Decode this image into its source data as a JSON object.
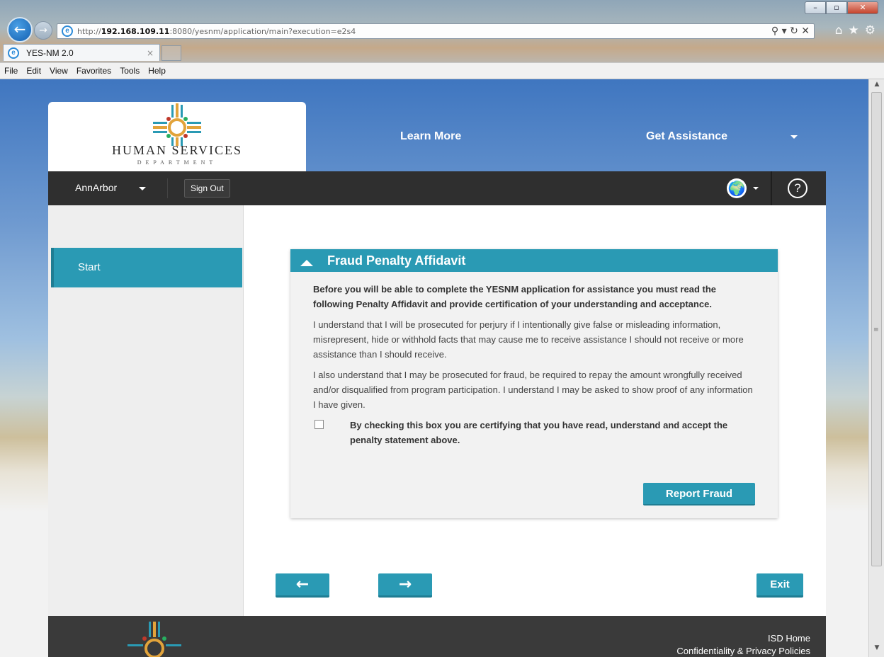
{
  "browser": {
    "url_prefix": "http://",
    "url_host": "192.168.109.11",
    "url_rest": ":8080/yesnm/application/main?execution=e2s4",
    "address_tools": "⚲ ▾ ↻ ✕",
    "tab_title": "YES-NM 2.0",
    "tab_close": "×",
    "menu": [
      "File",
      "Edit",
      "View",
      "Favorites",
      "Tools",
      "Help"
    ],
    "window_controls": {
      "minimize": "–",
      "maximize": "▫",
      "close": "✕"
    }
  },
  "header": {
    "logo_main": "HUMAN  SERVICES",
    "logo_sub": "DEPARTMENT",
    "links": {
      "learn_more": "Learn More",
      "get_assistance": "Get Assistance"
    }
  },
  "userbar": {
    "username": "AnnArbor",
    "sign_out": "Sign Out",
    "help": "?"
  },
  "sidenav": {
    "items": [
      {
        "label": "Start"
      }
    ]
  },
  "affidavit": {
    "title": "Fraud Penalty Affidavit",
    "intro": "Before you will be able to complete the YESNM application for assistance you must read the following Penalty Affidavit and provide certification of your understanding and acceptance.",
    "paragraph1": "I understand that I will be prosecuted for perjury if I intentionally give false or misleading information, misrepresent, hide or withhold facts that may cause me to receive assistance I should not receive or more assistance than I should receive.",
    "paragraph2": "I also understand that I may be prosecuted for fraud, be required to repay the amount wrongfully received and/or disqualified from program participation. I understand I may be asked to show proof of any information I have given.",
    "certification": "By checking this box you are certifying that you have read, understand and accept the penalty statement above.",
    "report_fraud": "Report Fraud"
  },
  "navigation": {
    "back": "←",
    "next": "→",
    "exit": "Exit"
  },
  "footer": {
    "isd_home": "ISD Home",
    "privacy": "Confidentiality & Privacy Policies"
  },
  "colors": {
    "accent": "#2a9ab4",
    "bar": "#2f2f2f"
  }
}
